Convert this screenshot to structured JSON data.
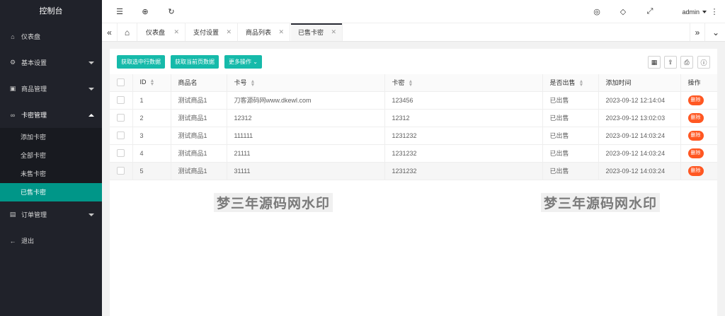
{
  "sidebar": {
    "title": "控制台",
    "items": [
      {
        "label": "仪表盘"
      },
      {
        "label": "基本设置"
      },
      {
        "label": "商品管理"
      },
      {
        "label": "卡密管理"
      },
      {
        "label": "订单管理"
      },
      {
        "label": "退出"
      }
    ],
    "sub_items": [
      {
        "label": "添加卡密"
      },
      {
        "label": "全部卡密"
      },
      {
        "label": "未售卡密"
      },
      {
        "label": "已售卡密"
      }
    ]
  },
  "header": {
    "user": "admin"
  },
  "tabs": [
    {
      "label": "仪表盘"
    },
    {
      "label": "支付设置"
    },
    {
      "label": "商品列表"
    },
    {
      "label": "已售卡密"
    }
  ],
  "toolbar": {
    "btn_selected": "获取选中行数据",
    "btn_page": "获取当前页数据",
    "btn_more": "更多操作"
  },
  "table": {
    "headers": [
      "ID",
      "商品名",
      "卡号",
      "卡密",
      "是否出售",
      "添加时间",
      "操作"
    ],
    "rows": [
      {
        "id": "1",
        "name": "测试商品1",
        "card": "刀客源码网www.dkewl.com",
        "secret": "123456",
        "sold": "已出售",
        "time": "2023-09-12 12:14:04",
        "action": "删除"
      },
      {
        "id": "2",
        "name": "测试商品1",
        "card": "12312",
        "secret": "12312",
        "sold": "已出售",
        "time": "2023-09-12 13:02:03",
        "action": "删除"
      },
      {
        "id": "3",
        "name": "测试商品1",
        "card": "111111",
        "secret": "1231232",
        "sold": "已出售",
        "time": "2023-09-12 14:03:24",
        "action": "删除"
      },
      {
        "id": "4",
        "name": "测试商品1",
        "card": "21111",
        "secret": "1231232",
        "sold": "已出售",
        "time": "2023-09-12 14:03:24",
        "action": "删除"
      },
      {
        "id": "5",
        "name": "测试商品1",
        "card": "31111",
        "secret": "1231232",
        "sold": "已出售",
        "time": "2023-09-12 14:03:24",
        "action": "删除"
      }
    ]
  },
  "watermark": "梦三年源码网水印",
  "colors": {
    "sidebar_bg": "#20222a",
    "active_item": "#009688",
    "button": "#16baaa",
    "danger": "#ff5722"
  }
}
